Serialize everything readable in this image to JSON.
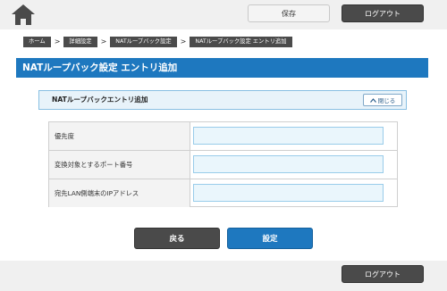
{
  "header": {
    "home_icon": "home-icon",
    "save_label": "保存",
    "logout_label": "ログアウト"
  },
  "breadcrumb": [
    "ホーム",
    "詳細設定",
    "NATループバック設定",
    "NATループバック設定 エントリ追加"
  ],
  "page_title": "NATループバック設定 エントリ追加",
  "section": {
    "title": "NATループバックエントリ追加",
    "close_label": "閉じる",
    "close_icon": "chevron-up-icon"
  },
  "form": {
    "fields": [
      {
        "label": "優先度",
        "value": "",
        "placeholder": ""
      },
      {
        "label": "変換対象とするポート番号",
        "value": "",
        "placeholder": ""
      },
      {
        "label": "宛先LAN側端末のIPアドレス",
        "value": "",
        "placeholder": ""
      }
    ]
  },
  "actions": {
    "back_label": "戻る",
    "set_label": "設定"
  },
  "footer": {
    "logout_label": "ログアウト"
  },
  "colors": {
    "accent": "#1e78bf",
    "dark_button": "#4a4a4a",
    "input_bg": "#eaf6fc"
  }
}
